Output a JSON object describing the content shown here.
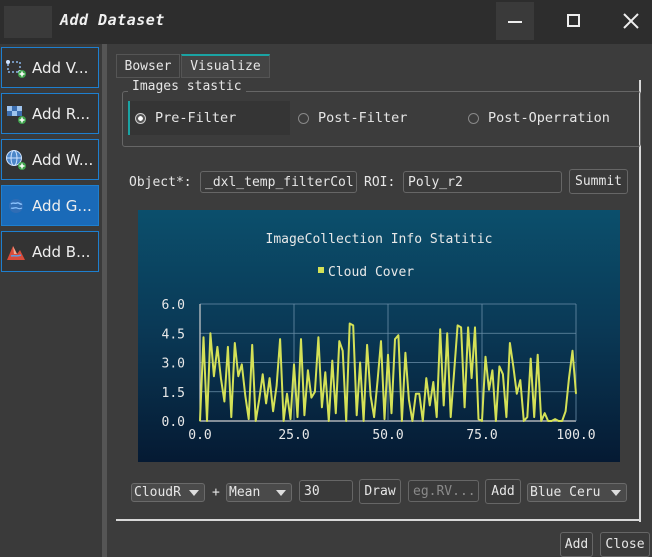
{
  "window": {
    "title": "Add Dataset",
    "controls": [
      "minimize-icon",
      "maximize-icon",
      "close-icon"
    ]
  },
  "sidebar": {
    "items": [
      {
        "label": "Add V...",
        "icon": "vector-layer-icon",
        "active": false
      },
      {
        "label": "Add R...",
        "icon": "raster-layer-icon",
        "active": false
      },
      {
        "label": "Add W...",
        "icon": "web-globe-icon",
        "active": false
      },
      {
        "label": "Add G...",
        "icon": "earth-engine-globe-icon",
        "active": true
      },
      {
        "label": "Add B...",
        "icon": "basemap-icon",
        "active": false
      }
    ]
  },
  "tabs": [
    {
      "label": "Bowser",
      "active": false
    },
    {
      "label": "Visualize",
      "active": true
    }
  ],
  "group": {
    "title": "Images stastic",
    "options": [
      {
        "label": "Pre-Filter",
        "checked": true
      },
      {
        "label": "Post-Filter",
        "checked": false
      },
      {
        "label": "Post-Operration",
        "checked": false
      }
    ]
  },
  "form": {
    "object_label": "Object*:",
    "object_value": "_dxl_temp_filterCol",
    "roi_label": "ROI:",
    "roi_value": "Poly_r2",
    "submit_label": "Summit"
  },
  "chart_data": {
    "type": "line",
    "title": "ImageCollection Info Statitic",
    "legend": "top-center",
    "series": [
      {
        "name": "Cloud Cover",
        "color": "#d4e157",
        "values": [
          0.0,
          4.3,
          0.0,
          4.5,
          2.3,
          3.8,
          2.2,
          1.0,
          3.8,
          0.2,
          4.0,
          2.3,
          2.9,
          1.3,
          0.1,
          3.9,
          0.0,
          1.1,
          2.4,
          0.9,
          2.2,
          0.5,
          1.8,
          4.2,
          0.0,
          1.4,
          0.1,
          2.9,
          0.2,
          4.2,
          0.3,
          2.6,
          1.2,
          1.5,
          4.3,
          0.7,
          2.5,
          0.0,
          3.1,
          0.4,
          4.1,
          3.6,
          0.0,
          5.0,
          4.9,
          0.3,
          3.0,
          0.0,
          3.9,
          1.3,
          0.2,
          2.1,
          4.1,
          0.1,
          3.4,
          0.4,
          4.2,
          4.4,
          0.0,
          3.5,
          1.1,
          0.0,
          1.4,
          1.4,
          0.0,
          2.2,
          0.8,
          2.0,
          0.2,
          4.7,
          0.8,
          4.5,
          0.2,
          2.5,
          4.9,
          4.8,
          0.7,
          4.8,
          2.2,
          4.8,
          0.1,
          0.0,
          3.3,
          1.6,
          2.6,
          0.0,
          2.8,
          2.4,
          0.2,
          4.0,
          2.8,
          1.4,
          2.1,
          0.0,
          0.2,
          3.2,
          0.2,
          3.4,
          0.0,
          0.4,
          0.0,
          0.0,
          0.1,
          0.0,
          0.0,
          0.5,
          2.2,
          3.6,
          1.4
        ]
      }
    ],
    "x_ticks": [
      "0.0",
      "25.0",
      "50.0",
      "75.0",
      "100.0"
    ],
    "y_ticks": [
      "0.0",
      "1.5",
      "3.0",
      "4.5",
      "6.0"
    ],
    "xlim": [
      0,
      100
    ],
    "ylim": [
      0,
      6
    ],
    "grid": true
  },
  "controls": {
    "band_combo": "CloudR",
    "plus_label": "+",
    "reducer_combo": "Mean",
    "count_value": "30",
    "draw_label": "Draw",
    "expr_placeholder": "eg.RV...",
    "add_label": "Add",
    "palette_combo": "Blue Ceru"
  },
  "footer": {
    "add_label": "Add",
    "close_label": "Close"
  }
}
